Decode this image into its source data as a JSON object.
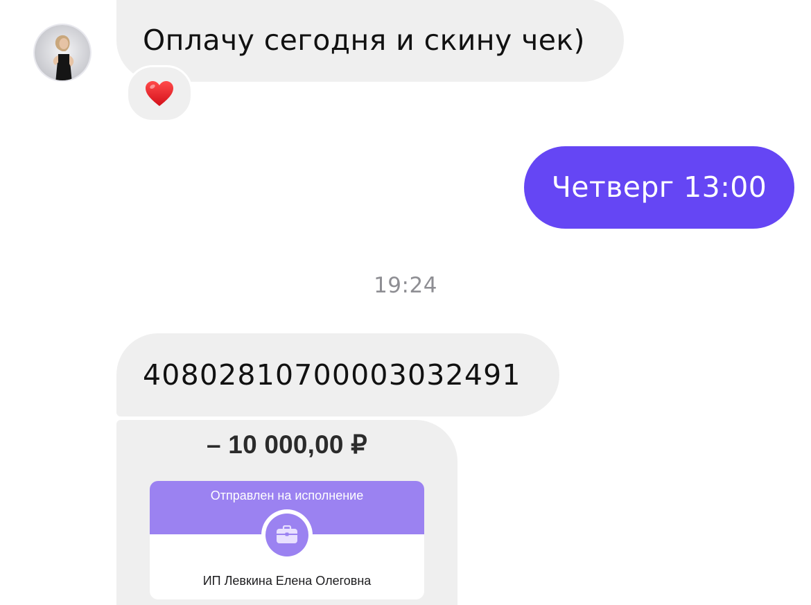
{
  "chat": {
    "messages": [
      {
        "direction": "incoming",
        "text": "Оплачу сегодня и скину чек)"
      },
      {
        "direction": "outgoing",
        "text": "Четверг 13:00"
      },
      {
        "direction": "incoming",
        "text": "40802810700003032491"
      }
    ],
    "reaction": {
      "icon": "heart-icon",
      "emoji": "❤️"
    },
    "timestamp": "19:24",
    "receipt": {
      "amount": "– 10 000,00 ₽",
      "status": "Отправлен на исполнение",
      "recipient": "ИП Левкина Елена Олеговна",
      "icon": "briefcase-icon"
    }
  },
  "colors": {
    "incoming_bubble": "#efefef",
    "outgoing_bubble": "#6546f4",
    "receipt_accent": "#9b82f1",
    "timestamp_text": "#8e8e93"
  }
}
